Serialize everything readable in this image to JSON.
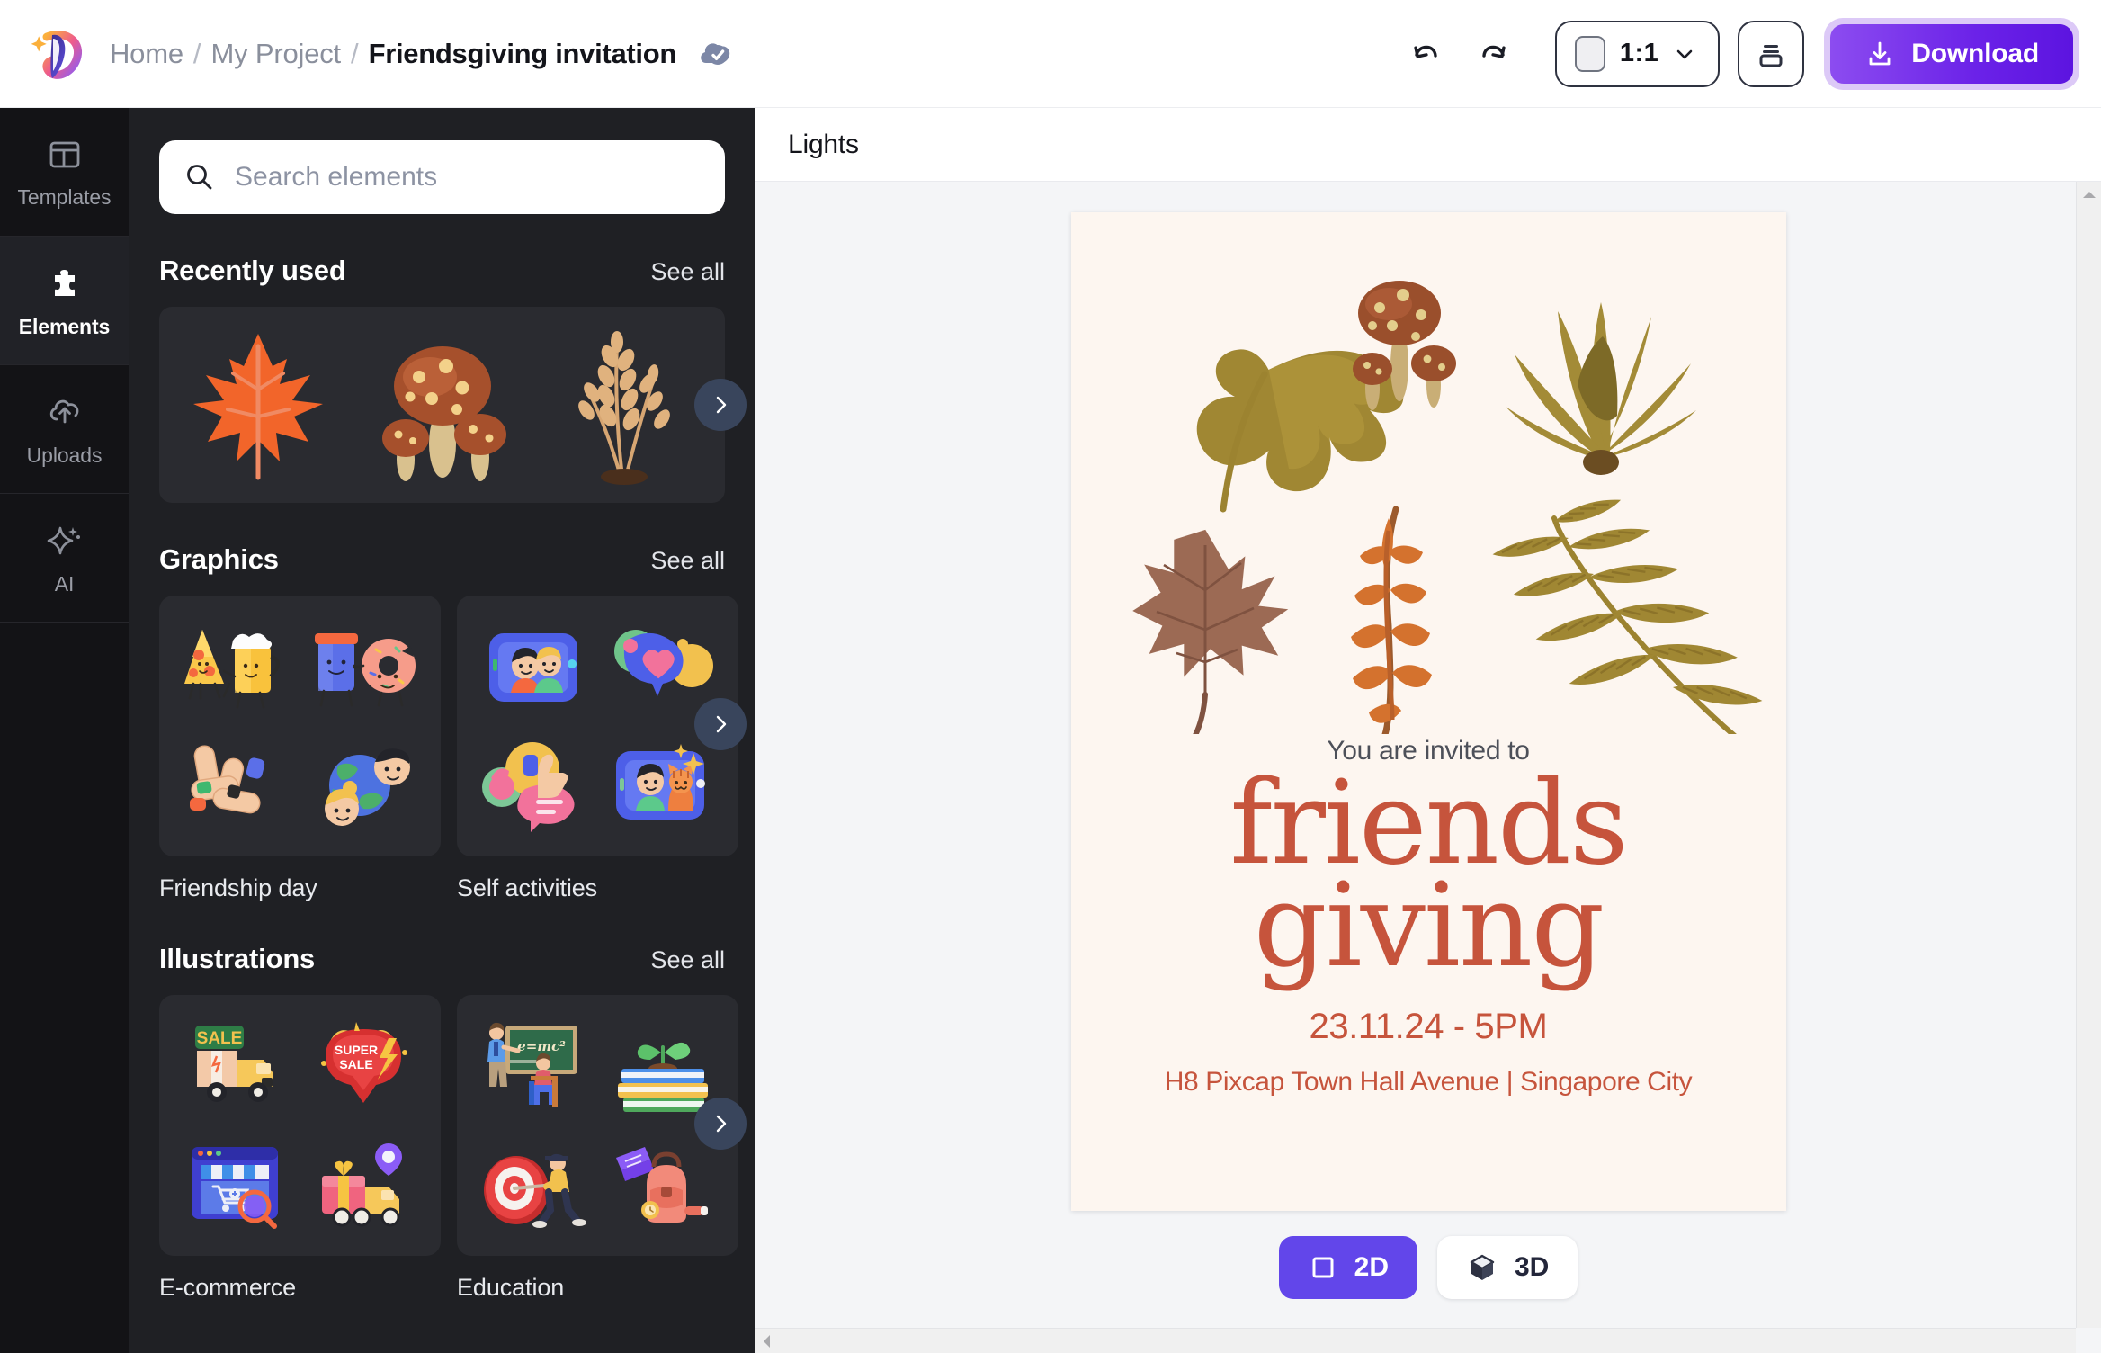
{
  "app": {
    "name": "Pixcap",
    "logo_icon": "pixcap-logo-icon"
  },
  "topbar": {
    "breadcrumb": [
      {
        "label": "Home",
        "current": false
      },
      {
        "label": "My Project",
        "current": false
      },
      {
        "label": "Friendsgiving invitation",
        "current": true
      }
    ],
    "separator": "/",
    "save_status_icon": "cloud-check-icon",
    "undo_icon": "undo-arrow-icon",
    "redo_icon": "redo-arrow-icon",
    "aspect_ratio": {
      "value": "1:1",
      "swatch_icon": "square-frame-icon",
      "chevron_icon": "chevron-down-icon"
    },
    "panel_toggle_icon": "layers-panel-icon",
    "download": {
      "label": "Download",
      "icon": "download-icon",
      "color": "#6B22E8"
    }
  },
  "rail": {
    "items": [
      {
        "label": "Templates",
        "icon": "templates-grid-icon",
        "active": false
      },
      {
        "label": "Elements",
        "icon": "puzzle-piece-icon",
        "active": true
      },
      {
        "label": "Uploads",
        "icon": "cloud-upload-icon",
        "active": false
      },
      {
        "label": "AI",
        "icon": "sparkle-star-icon",
        "active": false
      }
    ]
  },
  "panel": {
    "search": {
      "placeholder": "Search elements",
      "value": "",
      "icon": "search-icon"
    },
    "sections": [
      {
        "title": "Recently used",
        "see_all": "See all",
        "next_icon": "chevron-right-icon",
        "kind": "strip",
        "items": [
          {
            "name": "maple-leaf-3d"
          },
          {
            "name": "mushrooms-3d"
          },
          {
            "name": "wheat-sprig-3d"
          }
        ]
      },
      {
        "title": "Graphics",
        "see_all": "See all",
        "next_icon": "chevron-right-icon",
        "kind": "packs",
        "packs": [
          {
            "name": "Friendship day",
            "tiles": [
              "pizza-beer-3d",
              "cup-donut-3d",
              "hands-stack-3d",
              "globe-friends-3d"
            ]
          },
          {
            "name": "Self activities",
            "tiles": [
              "selfie-frame-3d",
              "heart-chat-3d",
              "thumbs-up-chat-3d",
              "pet-selfie-3d"
            ]
          }
        ]
      },
      {
        "title": "Illustrations",
        "see_all": "See all",
        "next_icon": "chevron-right-icon",
        "kind": "packs",
        "packs": [
          {
            "name": "E-commerce",
            "tiles": [
              "sale-truck-3d",
              "super-sale-badge-3d",
              "online-store-3d",
              "gift-delivery-3d"
            ]
          },
          {
            "name": "Education",
            "tiles": [
              "classroom-teacher-3d",
              "books-plant-3d",
              "target-archer-3d",
              "backpack-book-3d"
            ]
          }
        ]
      }
    ]
  },
  "canvas": {
    "header_title": "Lights",
    "background_color": "#F4F5F7",
    "poster": {
      "background_color": "#FDF6F0",
      "accent_color": "#C6543C",
      "pretitle": "You are invited to",
      "title_line1": "friends",
      "title_line2": "giving",
      "date": "23.11.24 - 5PM",
      "address": "H8 Pixcap Town Hall Avenue | Singapore City",
      "artwork": [
        "monstera-leaf-3d",
        "mushroom-cluster-3d",
        "coral-frond-3d",
        "maple-leaf-brown-3d",
        "orange-wheat-3d",
        "fern-branch-3d"
      ]
    },
    "mode_switch": [
      {
        "label": "2D",
        "icon": "square-outline-icon",
        "active": true
      },
      {
        "label": "3D",
        "icon": "cube-icon",
        "active": false
      }
    ],
    "scroll": {
      "up_icon": "caret-up-icon",
      "down_icon": "caret-down-icon",
      "left_icon": "caret-left-icon"
    }
  }
}
